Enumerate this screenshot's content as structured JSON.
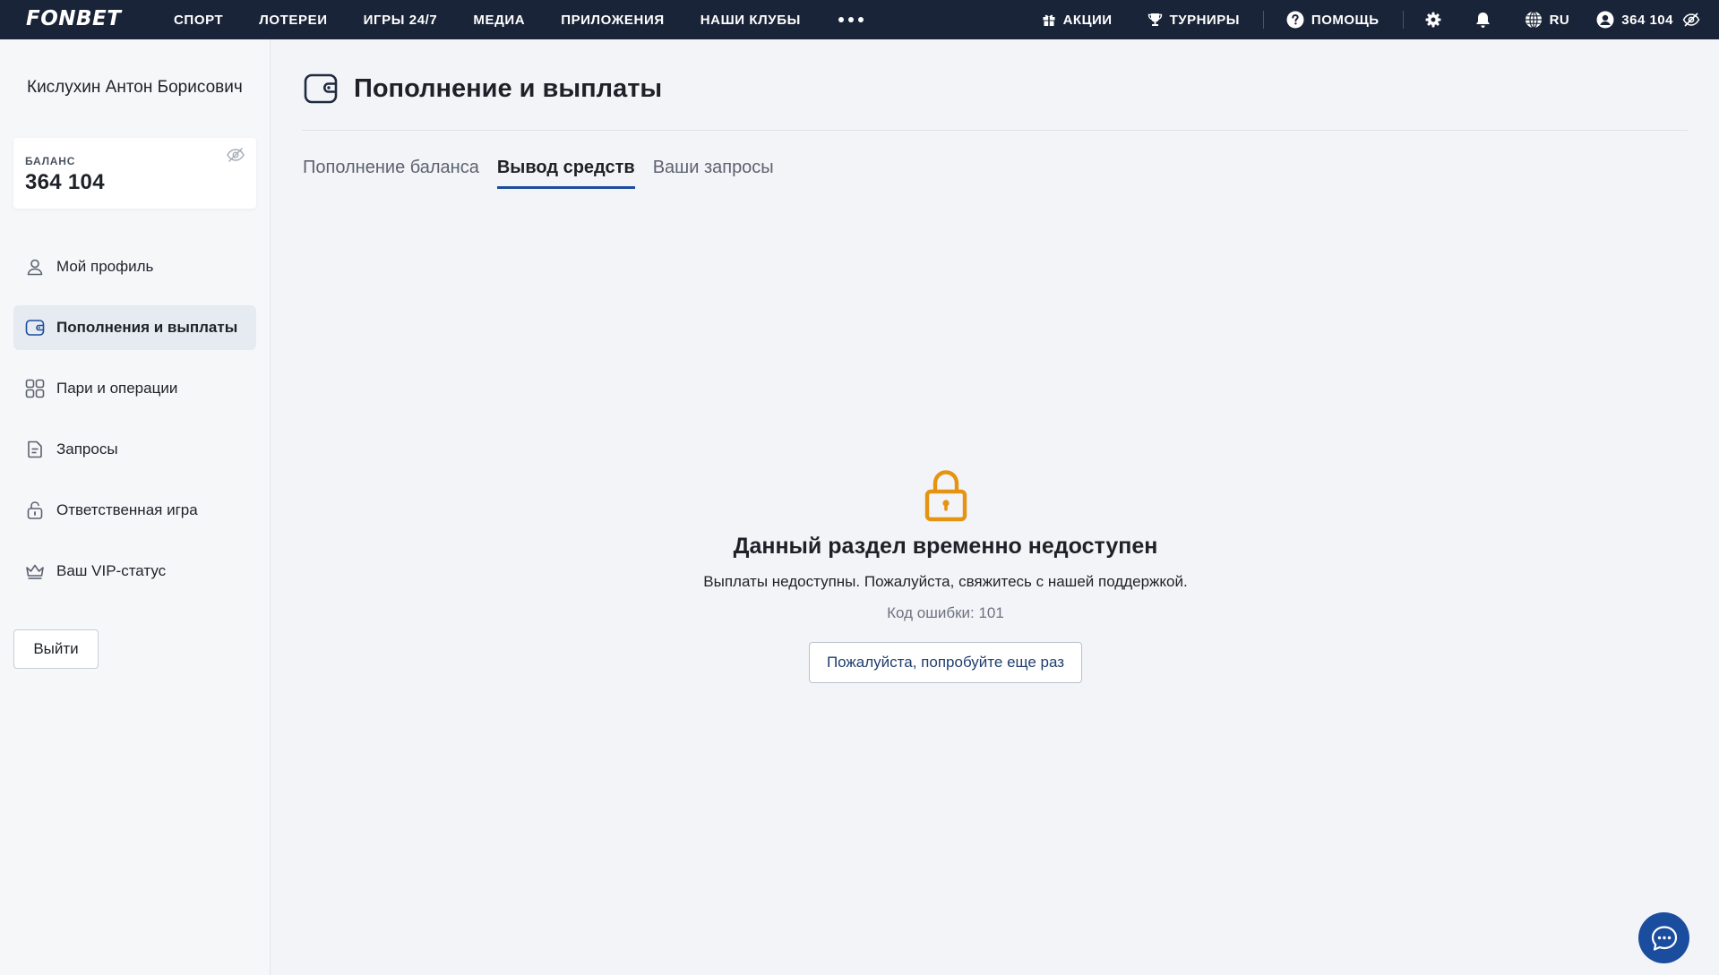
{
  "topbar": {
    "logo": "FONBET",
    "nav": [
      "СПОРТ",
      "ЛОТЕРЕИ",
      "ИГРЫ 24/7",
      "МЕДИА",
      "ПРИЛОЖЕНИЯ",
      "НАШИ КЛУБЫ"
    ],
    "promotions": "АКЦИИ",
    "tournaments": "ТУРНИРЫ",
    "help": "ПОМОЩЬ",
    "language": "RU",
    "balance": "364 104"
  },
  "sidebar": {
    "user_name": "Кислухин Антон Борисович",
    "balance_label": "БАЛАНС",
    "balance_value": "364 104",
    "menu": [
      {
        "label": "Мой профиль",
        "icon": "user-icon"
      },
      {
        "label": "Пополнения и выплаты",
        "icon": "wallet-icon",
        "active": true
      },
      {
        "label": "Пари и операции",
        "icon": "grid-icon"
      },
      {
        "label": "Запросы",
        "icon": "document-icon"
      },
      {
        "label": "Ответственная игра",
        "icon": "lock-icon"
      },
      {
        "label": "Ваш VIP-статус",
        "icon": "crown-icon"
      }
    ],
    "logout": "Выйти"
  },
  "main": {
    "title": "Пополнение и выплаты",
    "tabs": [
      {
        "label": "Пополнение баланса"
      },
      {
        "label": "Вывод средств",
        "active": true
      },
      {
        "label": "Ваши запросы"
      }
    ],
    "error": {
      "title": "Данный раздел временно недоступен",
      "description": "Выплаты недоступны. Пожалуйста, свяжитесь с нашей поддержкой.",
      "code": "Код ошибки: 101",
      "retry": "Пожалуйста, попробуйте еще раз"
    }
  },
  "colors": {
    "topbar": "#1a2438",
    "accent": "#1b4d9f",
    "lock": "#e59411",
    "active_menu": "#e6eaf1"
  }
}
